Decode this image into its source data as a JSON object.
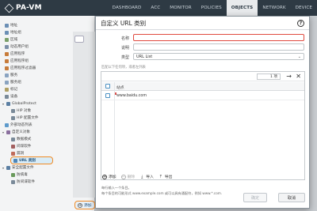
{
  "app": {
    "logo_text": "PA-VM"
  },
  "nav_tabs": [
    "DASHBOARD",
    "ACC",
    "MONITOR",
    "POLICIES",
    "OBJECTS",
    "NETWORK",
    "DEVICE"
  ],
  "active_tab": "OBJECTS",
  "sidebar": {
    "items": [
      {
        "label": "地址",
        "icon_color": "#6b8fb5"
      },
      {
        "label": "地址组",
        "icon_color": "#6b8fb5"
      },
      {
        "label": "区域",
        "icon_color": "#7aa06a"
      },
      {
        "label": "动态用户组",
        "icon_color": "#7b8fa8"
      },
      {
        "label": "应用程序",
        "icon_color": "#c77b3a"
      },
      {
        "label": "应用程序组",
        "icon_color": "#c77b3a"
      },
      {
        "label": "应用程序过滤器",
        "icon_color": "#c77b3a"
      },
      {
        "label": "服务",
        "icon_color": "#8aa3c0"
      },
      {
        "label": "服务组",
        "icon_color": "#8aa3c0"
      },
      {
        "label": "标记",
        "icon_color": "#b0a064"
      },
      {
        "label": "设备",
        "icon_color": "#7a8a99"
      },
      {
        "label": "GlobalProtect",
        "icon_color": "#5b7fa3"
      },
      {
        "label": "HIP 对象",
        "icon_color": "#7a8a99"
      },
      {
        "label": "HIP 配置文件",
        "icon_color": "#7a8a99"
      },
      {
        "label": "外部动态列表",
        "icon_color": "#5d9acb"
      },
      {
        "label": "自定义对象",
        "icon_color": "#8a6f9e"
      },
      {
        "label": "数据模式",
        "icon_color": "#7a8a99"
      },
      {
        "label": "间谍软件",
        "icon_color": "#a36060"
      },
      {
        "label": "漏洞",
        "icon_color": "#c06c5a"
      },
      {
        "label": "URL 类别",
        "icon_color": "#4f86b8"
      },
      {
        "label": "安全配置文件",
        "icon_color": "#5b7fa3"
      },
      {
        "label": "防病毒",
        "icon_color": "#6a9a5c"
      },
      {
        "label": "防间谍软件",
        "icon_color": "#7a8a99"
      }
    ],
    "bottom_button_label": "添加"
  },
  "modal": {
    "title": "自定义 URL 类别",
    "help_icon": "help-icon",
    "name_label": "名称",
    "name_value": "",
    "description_label": "说明",
    "description_value": "",
    "type_label": "类型",
    "type_value": "URL List",
    "hint": "匹配以下任何项，或者左列表",
    "counter_text": "1 项",
    "column_header": "站点",
    "rows": [
      "www.baidu.com"
    ],
    "footer": {
      "add_label": "添加",
      "delete_label": "删除",
      "import_label": "导入",
      "export_label": "导出"
    },
    "note_line1": "每行输入一个条目。",
    "note_line2": "每个条目的可能形式 www.example.com 或可以具有通配符，例如 www.*.com.",
    "ok_label": "确定",
    "cancel_label": "取消"
  }
}
